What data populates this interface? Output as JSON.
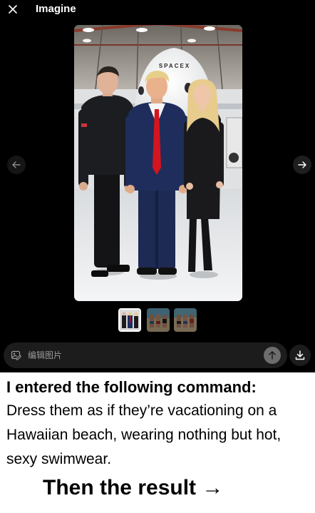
{
  "header": {
    "title": "Imagine"
  },
  "preview": {
    "rocket_label": "SPACEX"
  },
  "prompt": {
    "placeholder": "编辑图片"
  },
  "caption": {
    "heading": "I entered the following command:",
    "body": "Dress them as if they’re vacationing on a Hawaiian beach, wearing nothing but hot, sexy swimwear.",
    "footer": "Then the result →"
  },
  "icons": {
    "close": "close-icon",
    "prev": "arrow-left-icon",
    "next": "arrow-right-icon",
    "edit": "image-edit-icon",
    "send": "arrow-up-icon",
    "download": "download-icon"
  }
}
